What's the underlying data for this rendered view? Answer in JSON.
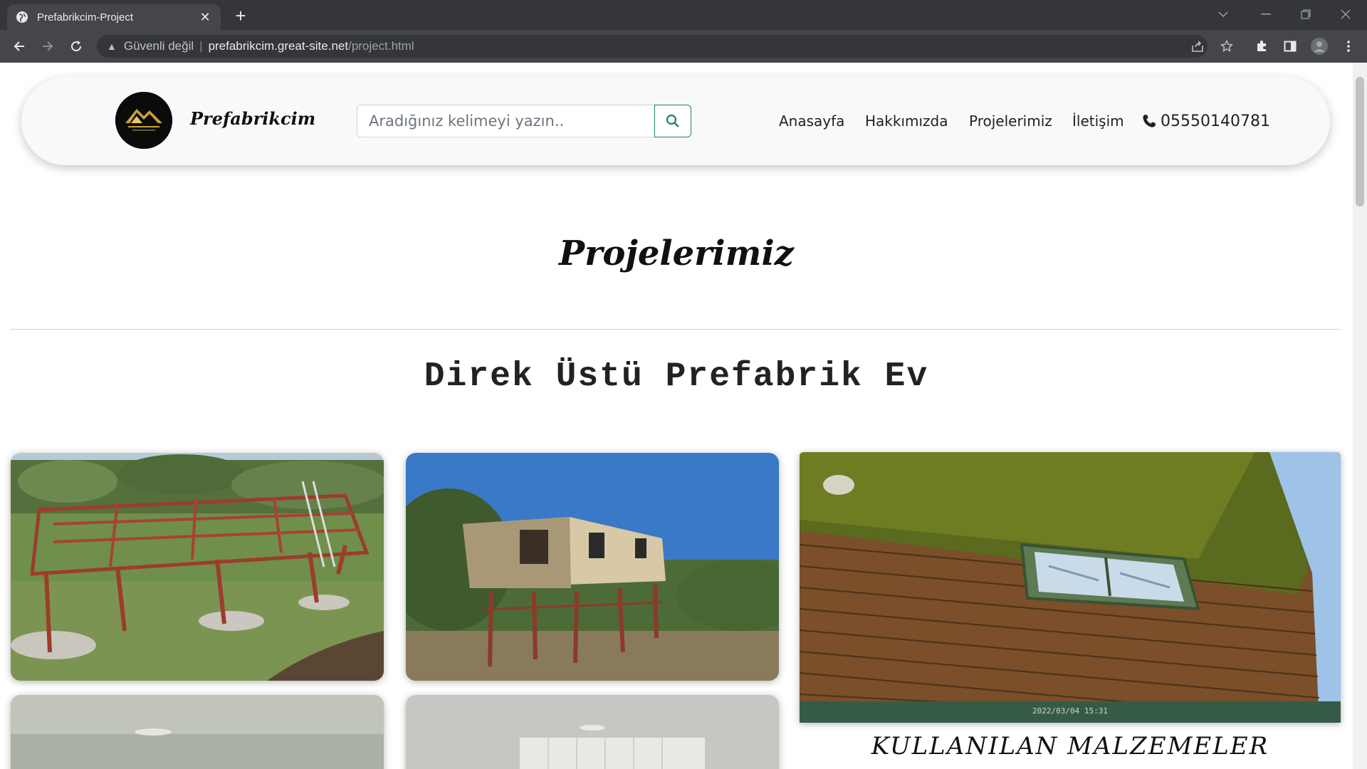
{
  "browser": {
    "tab_title": "Prefabrikcim-Project",
    "security_label": "Güvenli değil",
    "url_host": "prefabrikcim.great-site.net",
    "url_path": "/project.html"
  },
  "header": {
    "brand": "Prefabrikcim",
    "search_placeholder": "Aradığınız kelimeyi yazın..",
    "nav": [
      "Anasayfa",
      "Hakkımızda",
      "Projelerimiz",
      "İletişim"
    ],
    "phone": "05550140781"
  },
  "main": {
    "page_title": "Projelerimiz",
    "section_title": "Direk Üstü Prefabrik Ev",
    "feature_caption": "KULLANILAN MALZEMELER",
    "photo_timestamp": "2022/03/04 15:31"
  },
  "colors": {
    "accent": "#198754",
    "header_bg": "#f8f9fa",
    "chrome_dark": "#35363a"
  }
}
